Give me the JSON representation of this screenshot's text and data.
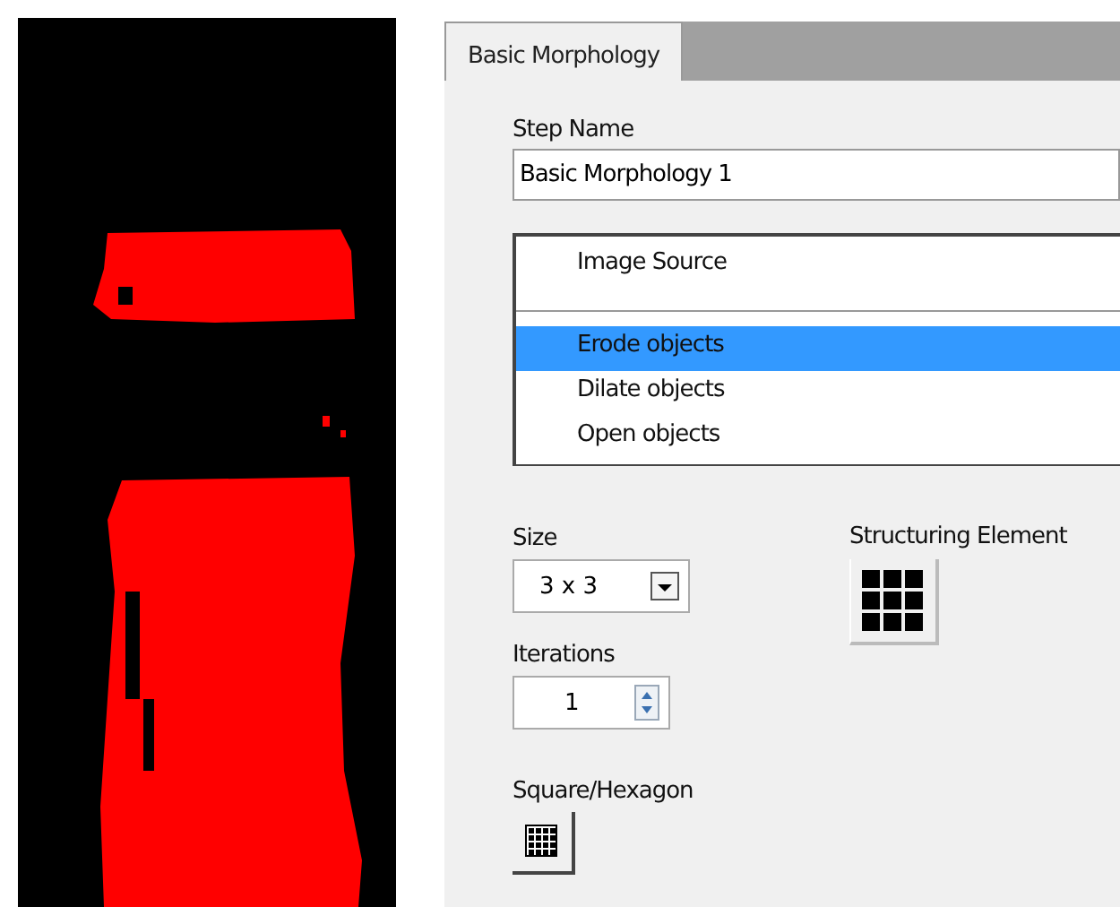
{
  "tabs": [
    {
      "label": "Basic Morphology",
      "selected": true
    }
  ],
  "step_name": {
    "label": "Step Name",
    "value": "Basic Morphology 1"
  },
  "steps_list": {
    "items": [
      {
        "label": "Image Source",
        "kind": "source",
        "selected": false
      },
      {
        "label": "Erode objects",
        "kind": "step",
        "selected": true
      },
      {
        "label": "Dilate objects",
        "kind": "step",
        "selected": false
      },
      {
        "label": "Open objects",
        "kind": "step",
        "selected": false
      }
    ]
  },
  "size": {
    "label": "Size",
    "value": "3 x 3"
  },
  "structuring_element": {
    "label": "Structuring Element"
  },
  "iterations": {
    "label": "Iterations",
    "value": "1"
  },
  "square_hexagon": {
    "label": "Square/Hexagon"
  }
}
